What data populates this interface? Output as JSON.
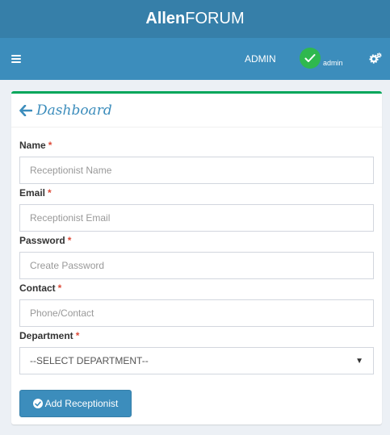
{
  "brand": {
    "bold": "Allen",
    "rest": "FORUM"
  },
  "nav": {
    "admin_label": "ADMIN",
    "user_name": "admin"
  },
  "box": {
    "title": "Dashboard",
    "fields": [
      {
        "label": "Name",
        "placeholder": "Receptionist Name"
      },
      {
        "label": "Email",
        "placeholder": "Receptionist Email"
      },
      {
        "label": "Password",
        "placeholder": "Create Password"
      },
      {
        "label": "Contact",
        "placeholder": "Phone/Contact"
      }
    ],
    "department": {
      "label": "Department",
      "selected": "--SELECT DEPARTMENT--"
    },
    "required_mark": "*",
    "submit_label": "Add Receptionist"
  },
  "colors": {
    "header": "#367fa9",
    "nav": "#3c8dbc",
    "accent_top": "#00a65a",
    "required": "#dd4b39",
    "avatar": "#2fb84f"
  },
  "icons": [
    "bars-icon",
    "check-icon",
    "gears-icon",
    "arrow-left-icon",
    "check-circle-icon"
  ]
}
